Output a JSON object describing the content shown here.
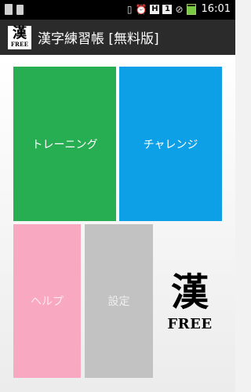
{
  "status_bar": {
    "time": "16:01",
    "icons": {
      "left": [
        "image-icon",
        "sd-card-icon"
      ],
      "right": [
        "vibrate-icon",
        "alarm-icon",
        "h-signal-icon",
        "sim-1-icon",
        "no-signal-icon",
        "battery-charging-icon"
      ]
    },
    "h_label": "H",
    "sim_label": "1"
  },
  "app_bar": {
    "title": "漢字練習帳 [無料版]",
    "icon_kanji": "漢",
    "icon_free": "FREE"
  },
  "tiles": {
    "training": {
      "label": "トレーニング",
      "color": "#27ae52"
    },
    "challenge": {
      "label": "チャレンジ",
      "color": "#0ea0e6"
    },
    "help": {
      "label": "ヘルプ",
      "color": "#f9a8c2"
    },
    "settings": {
      "label": "設定",
      "color": "#c2c2c2"
    }
  },
  "logo": {
    "kanji": "漢",
    "free": "FREE"
  }
}
